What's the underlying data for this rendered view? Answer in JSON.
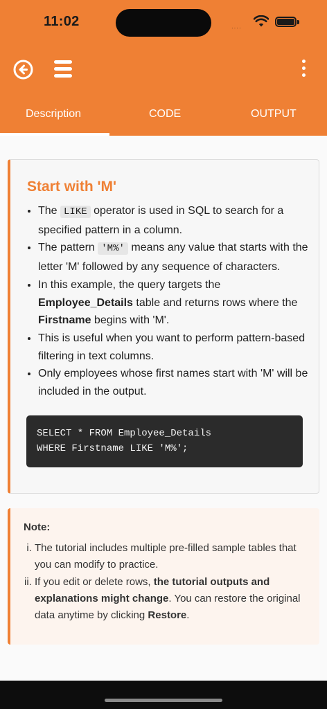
{
  "status_bar": {
    "time": "11:02",
    "signal": "····"
  },
  "tabs": [
    {
      "label": "Description"
    },
    {
      "label": "CODE"
    },
    {
      "label": "OUTPUT"
    }
  ],
  "card": {
    "title": "Start with 'M'",
    "bullets": {
      "b1_pre": "The ",
      "b1_code": "LIKE",
      "b1_post": " operator is used in SQL to search for a specified pattern in a column.",
      "b2_pre": "The pattern ",
      "b2_code": "'M%'",
      "b2_post": " means any value that starts with the letter 'M' followed by any sequence of characters.",
      "b3_pre": "In this example, the query targets the ",
      "b3_bold1": "Employee_Details",
      "b3_mid": " table and returns rows where the ",
      "b3_bold2": "Firstname",
      "b3_post": " begins with 'M'.",
      "b4": "This is useful when you want to perform pattern-based filtering in text columns.",
      "b5": "Only employees whose first names start with 'M' will be included in the output."
    },
    "code_line1": "SELECT * FROM Employee_Details",
    "code_line2": "WHERE Firstname LIKE 'M%';"
  },
  "note": {
    "title": "Note:",
    "item1": "The tutorial includes multiple pre-filled sample tables that you can modify to practice.",
    "item2_pre": "If you edit or delete rows, ",
    "item2_bold1": "the tutorial outputs and explanations might change",
    "item2_mid": ". You can restore the original data anytime by clicking ",
    "item2_bold2": "Restore",
    "item2_post": "."
  },
  "colors": {
    "accent": "#ef8034",
    "code_bg": "#2b2b2b",
    "note_bg": "#fdf4ee"
  },
  "icons": {
    "back": "back-arrow-circle-icon",
    "menu": "hamburger-menu-icon",
    "more": "more-vertical-icon"
  }
}
